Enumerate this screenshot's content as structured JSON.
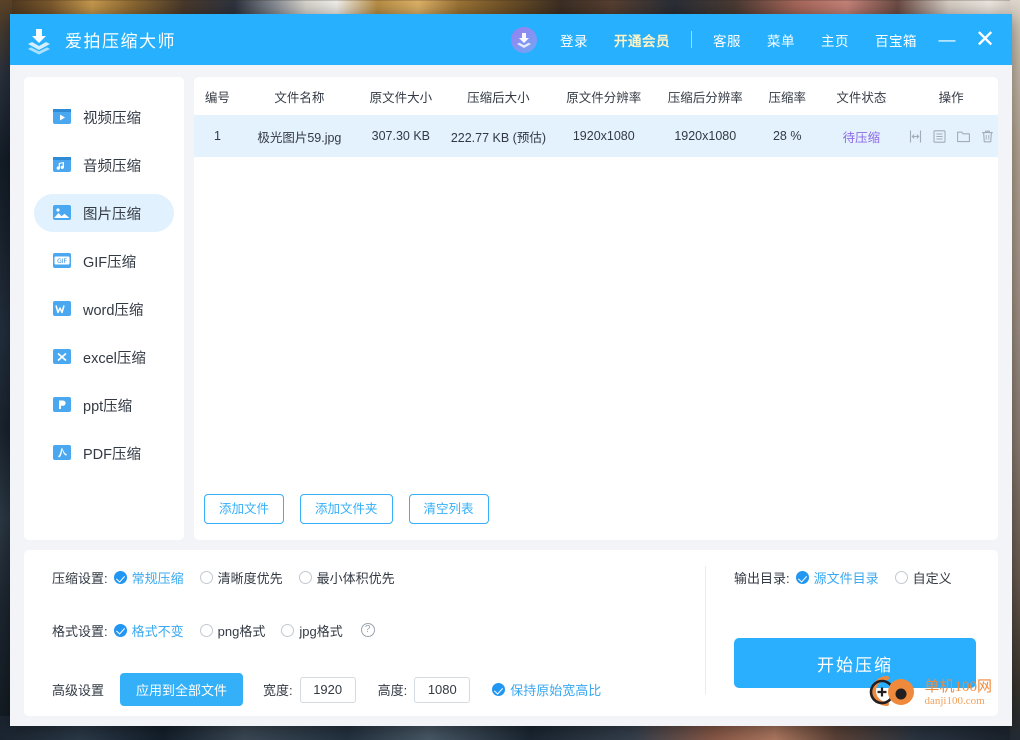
{
  "app": {
    "title": "爱拍压缩大师",
    "logo_icon": "stacked-download-logo"
  },
  "titlebar": {
    "avatar_icon": "user-avatar",
    "links": [
      {
        "label": "登录",
        "name": "login"
      },
      {
        "label": "开通会员",
        "name": "open-vip"
      },
      {
        "label": "客服",
        "name": "support"
      },
      {
        "label": "菜单",
        "name": "menu"
      },
      {
        "label": "主页",
        "name": "home"
      },
      {
        "label": "百宝箱",
        "name": "toolbox"
      }
    ],
    "minimize_label": "—",
    "close_label": "✕"
  },
  "sidebar": {
    "items": [
      {
        "label": "视频压缩",
        "icon": "video-compress-icon",
        "active": false
      },
      {
        "label": "音频压缩",
        "icon": "audio-compress-icon",
        "active": false
      },
      {
        "label": "图片压缩",
        "icon": "image-compress-icon",
        "active": true
      },
      {
        "label": "GIF压缩",
        "icon": "gif-compress-icon",
        "active": false
      },
      {
        "label": "word压缩",
        "icon": "word-compress-icon",
        "active": false
      },
      {
        "label": "excel压缩",
        "icon": "excel-compress-icon",
        "active": false
      },
      {
        "label": "ppt压缩",
        "icon": "ppt-compress-icon",
        "active": false
      },
      {
        "label": "PDF压缩",
        "icon": "pdf-compress-icon",
        "active": false
      }
    ]
  },
  "file_table": {
    "columns": [
      "编号",
      "文件名称",
      "原文件大小",
      "压缩后大小",
      "原文件分辨率",
      "压缩后分辨率",
      "压缩率",
      "文件状态",
      "操作"
    ],
    "rows": [
      {
        "index": "1",
        "name": "极光图片59.jpg",
        "orig_size": "307.30 KB",
        "new_size": "222.77 KB (预估)",
        "orig_res": "1920x1080",
        "new_res": "1920x1080",
        "ratio": "28 %",
        "status": "待压缩",
        "ops": [
          "resize-icon",
          "detail-icon",
          "open-folder-icon",
          "delete-icon"
        ]
      }
    ]
  },
  "file_buttons": [
    {
      "label": "添加文件",
      "name": "add-file"
    },
    {
      "label": "添加文件夹",
      "name": "add-folder"
    },
    {
      "label": "清空列表",
      "name": "clear-list"
    }
  ],
  "settings": {
    "compress": {
      "label": "压缩设置:",
      "options": [
        {
          "label": "常规压缩",
          "selected": true
        },
        {
          "label": "清晰度优先",
          "selected": false
        },
        {
          "label": "最小体积优先",
          "selected": false
        }
      ]
    },
    "format": {
      "label": "格式设置:",
      "options": [
        {
          "label": "格式不变",
          "selected": true
        },
        {
          "label": "png格式",
          "selected": false
        },
        {
          "label": "jpg格式",
          "selected": false
        }
      ],
      "help_icon": "question-mark-icon"
    },
    "advanced": {
      "label": "高级设置",
      "apply_button": "应用到全部文件",
      "width_label": "宽度:",
      "width_value": "1920",
      "height_label": "高度:",
      "height_value": "1080",
      "keep_ratio_label": "保持原始宽高比",
      "keep_ratio_selected": true
    },
    "output": {
      "label": "输出目录:",
      "options": [
        {
          "label": "源文件目录",
          "selected": true
        },
        {
          "label": "自定义",
          "selected": false
        }
      ]
    },
    "start_button": "开始压缩"
  },
  "watermark": {
    "cn": "单机100网",
    "en": "danji100.com",
    "icon": "camera-watermark-logo"
  },
  "colors": {
    "header_blue": "#27b0fd",
    "accent_blue": "#2aafff",
    "row_highlight": "#e4f2fd",
    "sidebar_active": "#e1f1fd",
    "status_purple": "#8d6ae8",
    "vip_gold": "#fff3c4",
    "watermark_orange": "#f08a3c"
  }
}
